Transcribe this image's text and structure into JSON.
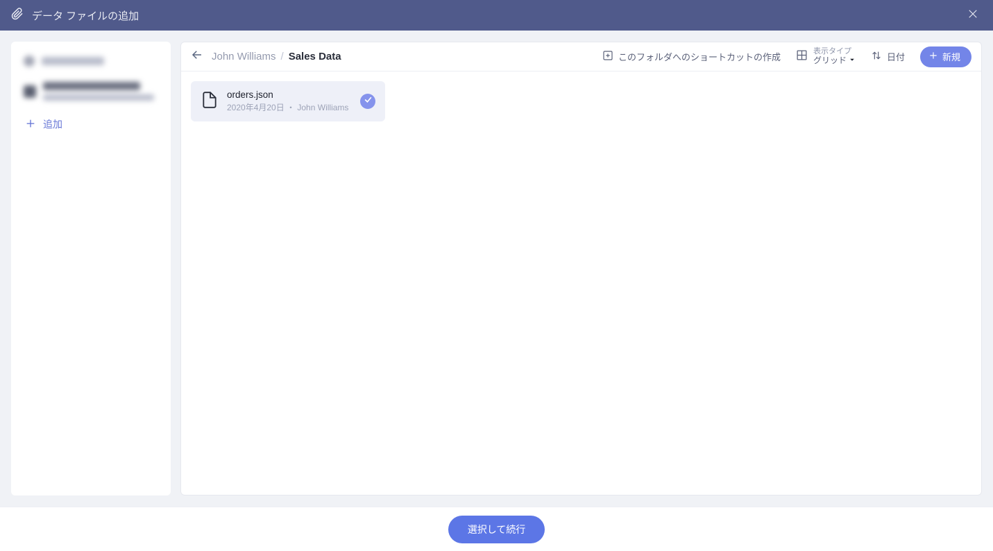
{
  "header": {
    "title": "データ ファイルの追加"
  },
  "sidebar": {
    "add_label": "追加"
  },
  "toolbar": {
    "breadcrumb_parent": "John Williams",
    "breadcrumb_sep": "/",
    "breadcrumb_current": "Sales Data",
    "shortcut_label": "このフォルダへのショートカットの作成",
    "view_type_label": "表示タイプ",
    "view_type_value": "グリッド",
    "sort_label": "日付",
    "new_button": "新規"
  },
  "files": [
    {
      "name": "orders.json",
      "meta": "2020年4月20日 ・ John Williams",
      "selected": true
    }
  ],
  "footer": {
    "confirm": "選択して続行"
  }
}
